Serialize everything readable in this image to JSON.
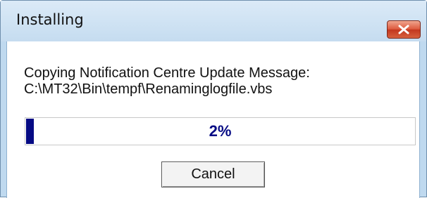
{
  "window": {
    "title": "Installing",
    "close_icon": "close-icon"
  },
  "message": {
    "line1": "Copying Notification Centre Update Message:",
    "line2": "C:\\MT32\\Bin\\tempf\\Renaminglogfile.vbs"
  },
  "progress": {
    "value": 0.02,
    "label": "2%",
    "fill_color": "#050a84"
  },
  "buttons": {
    "cancel_label": "Cancel"
  }
}
